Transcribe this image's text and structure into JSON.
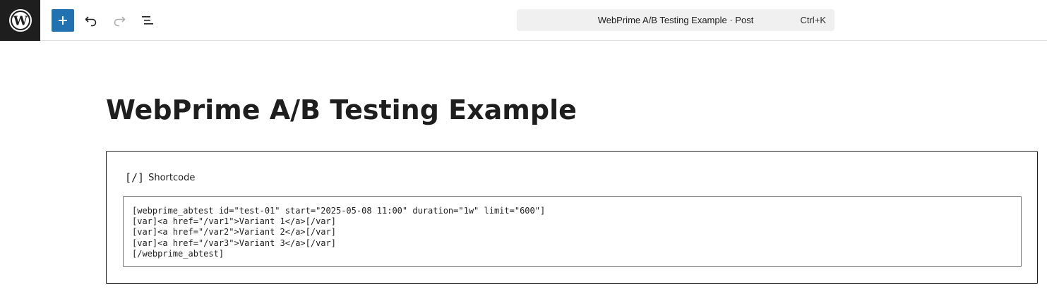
{
  "header": {
    "logo_icon": "wordpress-logo-icon",
    "add_icon": "plus-icon",
    "undo_icon": "undo-icon",
    "redo_icon": "redo-icon",
    "outline_icon": "document-outline-icon",
    "accent_color": "#2271b1",
    "command_bar": {
      "title": "WebPrime A/B Testing Example · Post",
      "shortcut": "Ctrl+K"
    }
  },
  "post": {
    "title": "WebPrime A/B Testing Example"
  },
  "shortcode_block": {
    "icon_glyph": "[/]",
    "icon_name": "shortcode-icon",
    "label": "Shortcode",
    "content": "[webprime_abtest id=\"test-01\" start=\"2025-05-08 11:00\" duration=\"1w\" limit=\"600\"]\n[var]<a href=\"/var1\">Variant 1</a>[/var]\n[var]<a href=\"/var2\">Variant 2</a>[/var]\n[var]<a href=\"/var3\">Variant 3</a>[/var]\n[/webprime_abtest]"
  }
}
